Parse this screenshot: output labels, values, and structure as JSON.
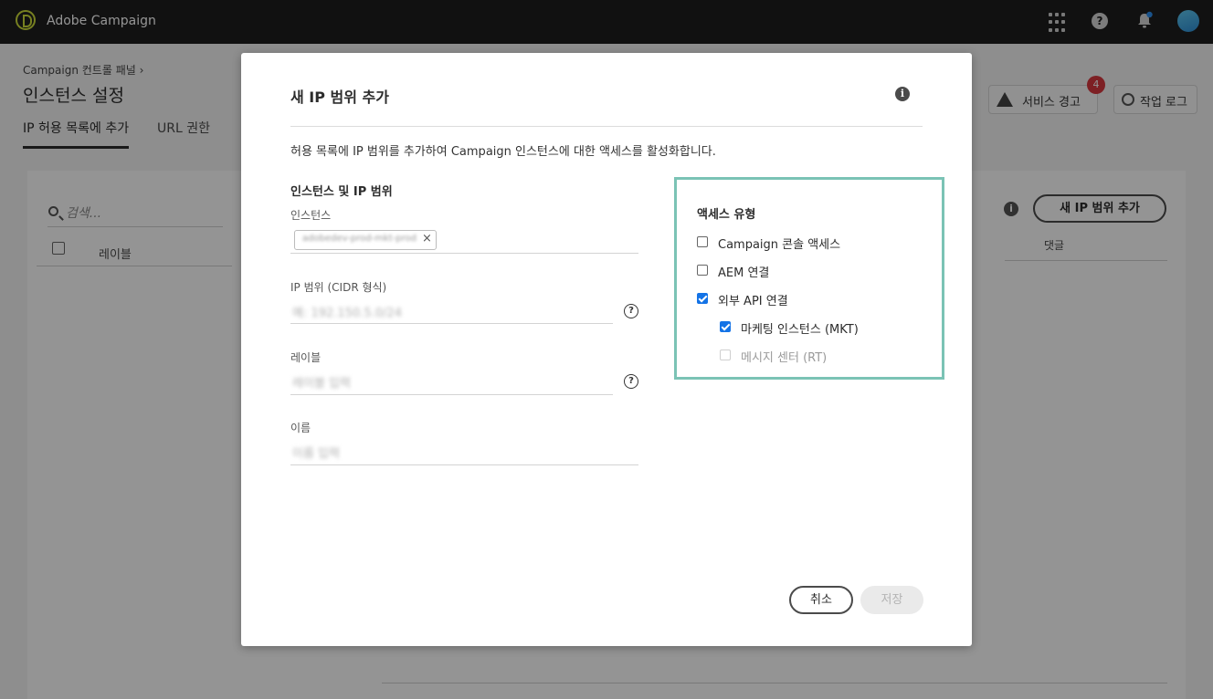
{
  "app": {
    "title": "Adobe Campaign"
  },
  "topbar": {
    "icons": [
      "apps-icon",
      "help-icon",
      "bell-icon",
      "avatar"
    ]
  },
  "page": {
    "breadcrumb": "Campaign 컨트롤 패널",
    "title": "인스턴스 설정",
    "tabs": [
      {
        "label": "IP 허용 목록에 추가",
        "active": true
      },
      {
        "label": "URL 권한",
        "active": false
      }
    ],
    "service_alert_label": "서비스 경고",
    "service_alert_count": "4",
    "job_log_label": "작업 로그",
    "search_placeholder": "검색...",
    "column_label": "레이블",
    "column_comment": "댓글",
    "add_button": "새 IP 범위 추가"
  },
  "dialog": {
    "title": "새 IP 범위 추가",
    "description": "허용 목록에 IP 범위를 추가하여 Campaign 인스턴스에 대한 액세스를 활성화합니다.",
    "section_title": "인스턴스 및 IP 범위",
    "instance_label": "인스턴스",
    "instance_tag": "adobedev-prod-mkt-prod",
    "ip_range_label": "IP 범위 (CIDR 형식)",
    "ip_range_placeholder": "예: 192.150.5.0/24",
    "label_label": "레이블",
    "label_placeholder": "레이블 입력",
    "name_label": "이름",
    "name_placeholder": "이름 입력",
    "access": {
      "title": "액세스 유형",
      "options": [
        {
          "label": "Campaign 콘솔 액세스",
          "checked": false,
          "disabled": false
        },
        {
          "label": "AEM 연결",
          "checked": false,
          "disabled": false
        },
        {
          "label": "외부 API 연결",
          "checked": true,
          "disabled": false
        },
        {
          "label": "마케팅 인스턴스 (MKT)",
          "checked": true,
          "disabled": false
        },
        {
          "label": "메시지 센터 (RT)",
          "checked": false,
          "disabled": true
        }
      ]
    },
    "cancel_label": "취소",
    "save_label": "저장"
  },
  "colors": {
    "topbar": "#1e1e1e",
    "accent": "#1473e6",
    "highlight": "#7bc3b5",
    "badge": "#d7373f"
  }
}
